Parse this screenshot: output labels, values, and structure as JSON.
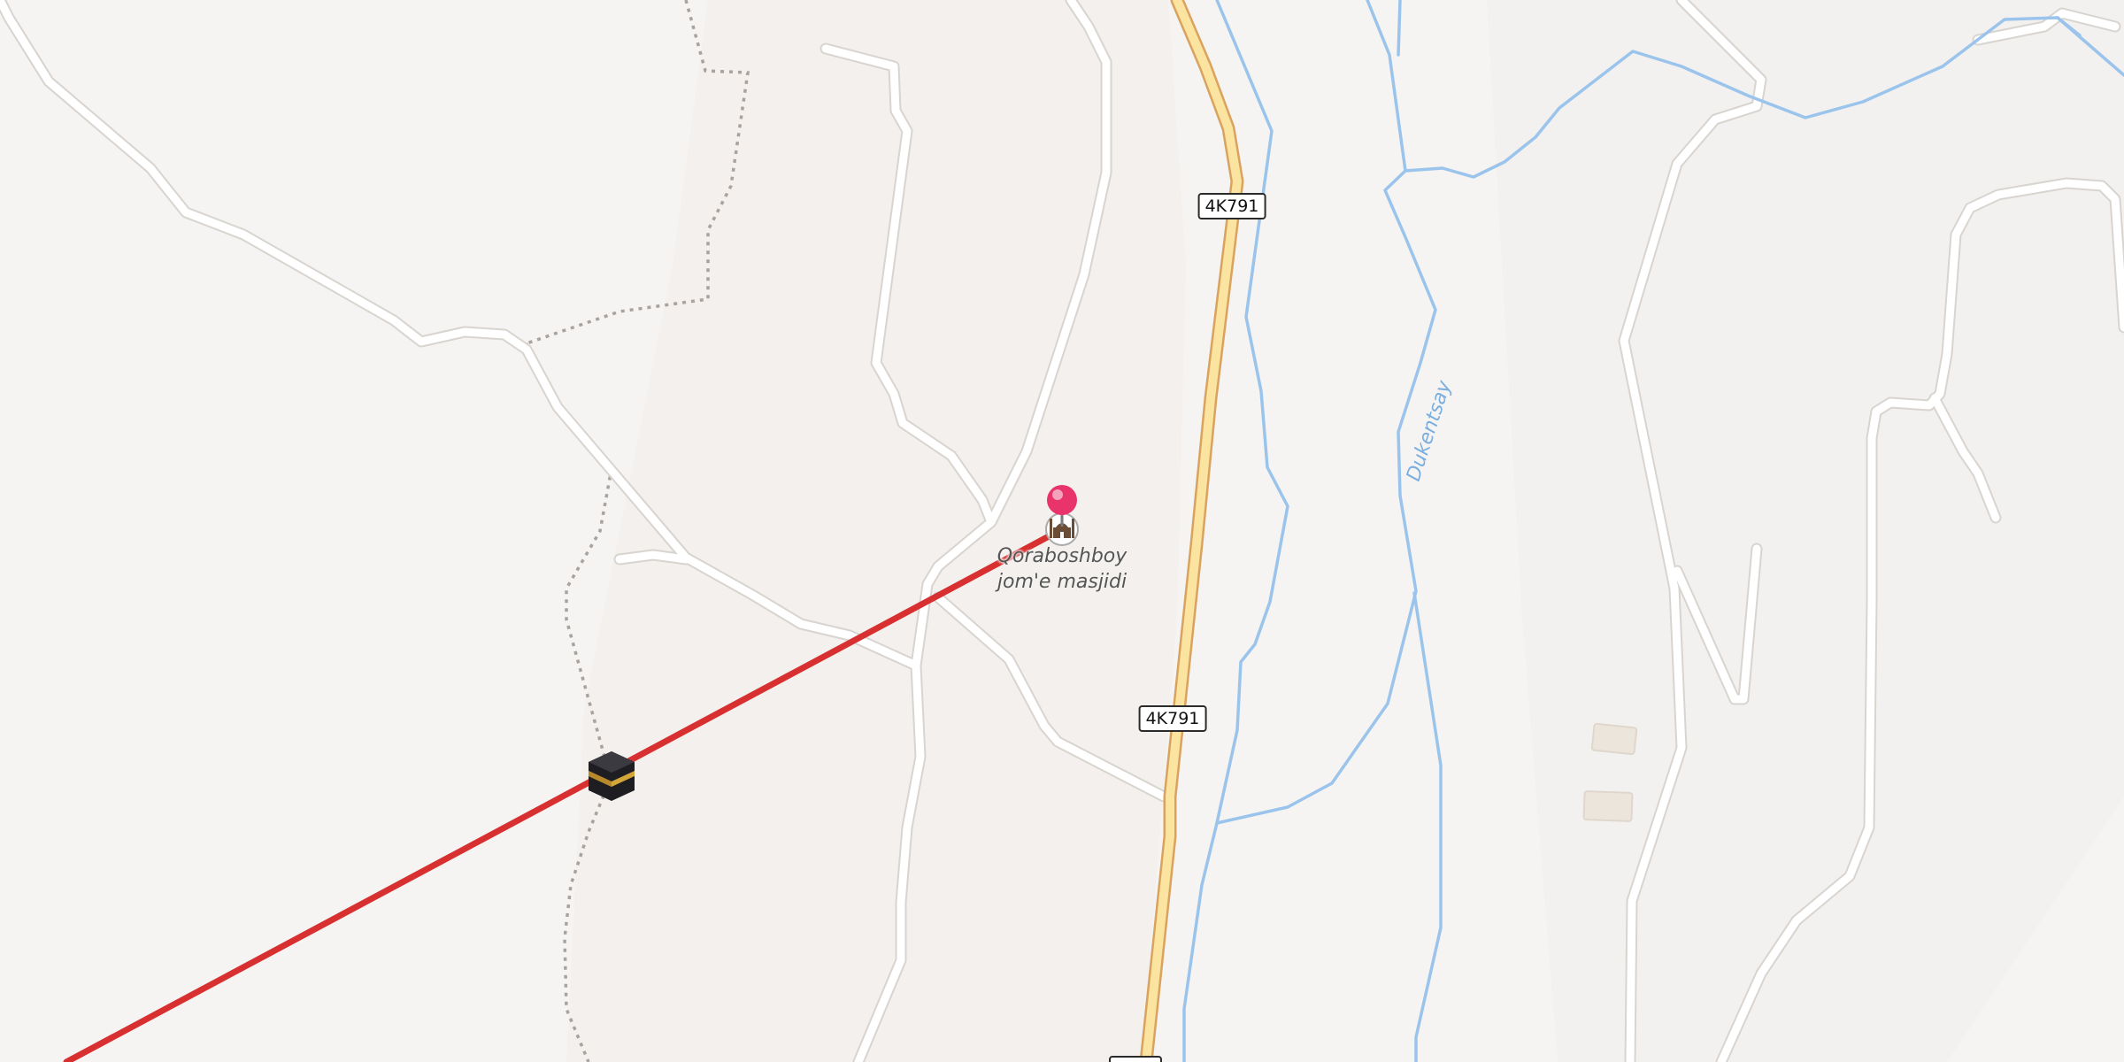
{
  "map": {
    "background_color": "#f6f4f2",
    "road_shields": [
      {
        "ref": "4K791"
      },
      {
        "ref": "4K791"
      }
    ],
    "poi": {
      "name_line_1": "Qoraboshboy",
      "name_line_2": "jom'e masjidi",
      "icon": "mosque-icon"
    },
    "water_label": "Dukentsay",
    "selected_marker": {
      "icon": "map-pin-icon",
      "color": "#e8336b"
    },
    "qibla_marker": {
      "icon": "kaaba-icon"
    },
    "qibla_line_color": "#d83030",
    "road_color": "#ffffff",
    "main_road_color": "#fbe3a0",
    "water_color": "#9ac4ec",
    "path_color": "#a9a29d"
  }
}
